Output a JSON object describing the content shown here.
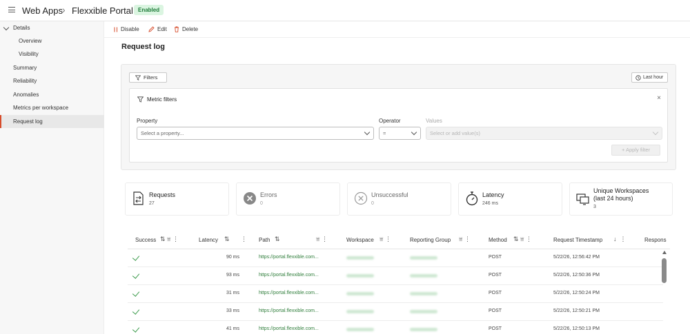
{
  "header": {
    "breadcrumb_root": "Web Apps",
    "page_name": "Flexxible Portal",
    "status_badge": "Enabled"
  },
  "sidebar": {
    "group_label": "Details",
    "items": [
      {
        "label": "Overview"
      },
      {
        "label": "Visibility"
      },
      {
        "label": "Summary"
      },
      {
        "label": "Reliability"
      },
      {
        "label": "Anomalies"
      },
      {
        "label": "Metrics per workspace"
      },
      {
        "label": "Request log",
        "active": true
      }
    ]
  },
  "toolbar": {
    "disable_label": "Disable",
    "edit_label": "Edit",
    "delete_label": "Delete"
  },
  "main": {
    "title": "Request log",
    "filters_label": "Filters",
    "time_range_label": "Last hour",
    "metric_filters": {
      "title": "Metric filters",
      "property_label": "Property",
      "property_placeholder": "Select a property...",
      "operator_label": "Operator",
      "operator_value": "=",
      "values_label": "Values",
      "values_placeholder": "Select or add value(s)",
      "apply_label": "+ Apply filter"
    }
  },
  "stats": [
    {
      "title": "Requests",
      "value": "27",
      "icon": "requests-icon"
    },
    {
      "title": "Errors",
      "value": "0",
      "icon": "error-circle-icon"
    },
    {
      "title": "Unsuccessful",
      "value": "0",
      "icon": "unsuccessful-circle-icon"
    },
    {
      "title": "Latency",
      "value": "246 ms",
      "icon": "stopwatch-icon"
    },
    {
      "title": "Unique Workspaces",
      "title2": "(last 24 hours)",
      "value": "3",
      "icon": "workspaces-icon"
    }
  ],
  "table": {
    "columns": [
      "Success",
      "Latency",
      "Path",
      "Workspace",
      "Reporting Group",
      "Method",
      "Request Timestamp",
      "Respons"
    ],
    "rows": [
      {
        "latency": "90 ms",
        "path": "https://portal.flexxible.com...",
        "method": "POST",
        "timestamp": "5/22/26, 12:56:42 PM"
      },
      {
        "latency": "93 ms",
        "path": "https://portal.flexxible.com...",
        "method": "POST",
        "timestamp": "5/22/26, 12:50:36 PM"
      },
      {
        "latency": "31 ms",
        "path": "https://portal.flexxible.com...",
        "method": "POST",
        "timestamp": "5/22/26, 12:50:24 PM"
      },
      {
        "latency": "33 ms",
        "path": "https://portal.flexxible.com...",
        "method": "POST",
        "timestamp": "5/22/26, 12:50:21 PM"
      },
      {
        "latency": "41 ms",
        "path": "https://portal.flexxible.com...",
        "method": "POST",
        "timestamp": "5/22/26, 12:50:13 PM"
      }
    ]
  },
  "colors": {
    "accent": "#d64c2b",
    "success_green": "#3a9a4a",
    "link_green": "#2e7d3a",
    "badge_bg": "#dbf5e1"
  }
}
